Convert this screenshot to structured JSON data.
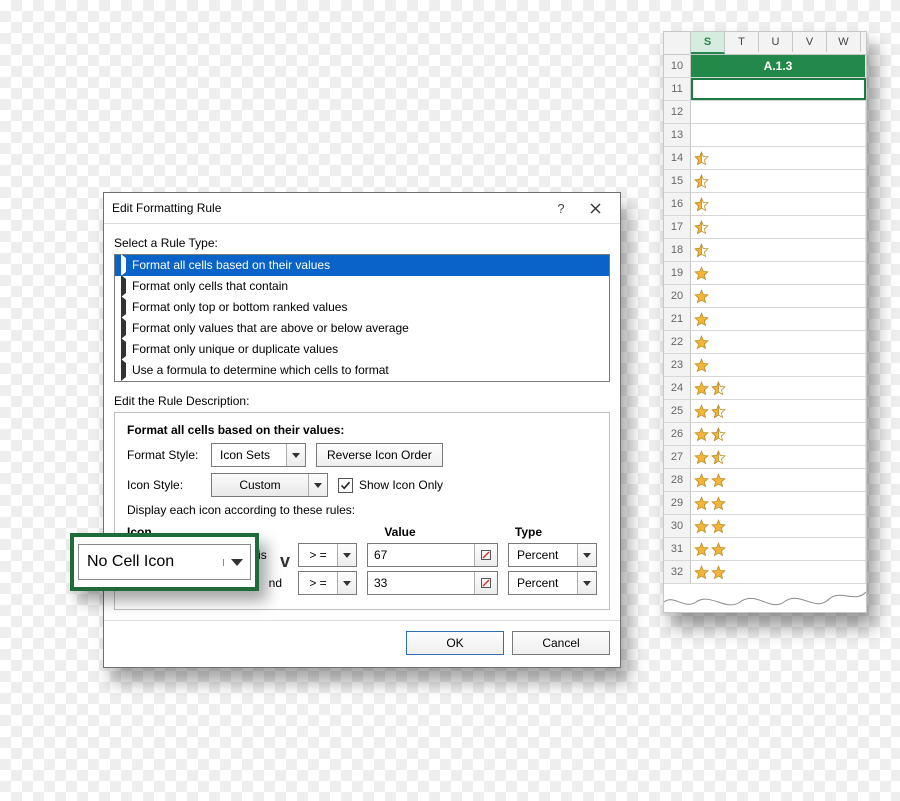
{
  "dialog": {
    "title": "Edit Formatting Rule",
    "help_symbol": "?",
    "select_label": "Select a Rule Type:",
    "rule_types": [
      "Format all cells based on their values",
      "Format only cells that contain",
      "Format only top or bottom ranked values",
      "Format only values that are above or below average",
      "Format only unique or duplicate values",
      "Use a formula to determine which cells to format"
    ],
    "edit_label": "Edit the Rule Description:",
    "desc_title": "Format all cells based on their values:",
    "format_style_label": "Format Style:",
    "format_style_value": "Icon Sets",
    "reverse_label": "Reverse Icon Order",
    "icon_style_label": "Icon Style:",
    "icon_style_value": "Custom",
    "show_icon_only_label": "Show Icon Only",
    "display_label": "Display each icon according to these rules:",
    "col_icon": "Icon",
    "col_value": "Value",
    "col_type": "Type",
    "when_label": "when value is",
    "and_label": "nd",
    "rules": [
      {
        "operator": "> =",
        "value": "67",
        "type": "Percent"
      },
      {
        "operator": "> =",
        "value": "33",
        "type": "Percent"
      }
    ],
    "ok_label": "OK",
    "cancel_label": "Cancel"
  },
  "callout": {
    "label": "No Cell Icon",
    "vtag": "v"
  },
  "sheet": {
    "columns": [
      "S",
      "T",
      "U",
      "V",
      "W"
    ],
    "active_column": "S",
    "title_cell": "A.1.3",
    "rows": [
      {
        "n": 10,
        "title": true
      },
      {
        "n": 11,
        "selected": true,
        "stars": []
      },
      {
        "n": 12,
        "stars": []
      },
      {
        "n": 13,
        "stars": []
      },
      {
        "n": 14,
        "stars": [
          "half"
        ]
      },
      {
        "n": 15,
        "stars": [
          "half"
        ]
      },
      {
        "n": 16,
        "stars": [
          "half"
        ]
      },
      {
        "n": 17,
        "stars": [
          "half"
        ]
      },
      {
        "n": 18,
        "stars": [
          "half"
        ]
      },
      {
        "n": 19,
        "stars": [
          "full"
        ]
      },
      {
        "n": 20,
        "stars": [
          "full"
        ]
      },
      {
        "n": 21,
        "stars": [
          "full"
        ]
      },
      {
        "n": 22,
        "stars": [
          "full"
        ]
      },
      {
        "n": 23,
        "stars": [
          "full"
        ]
      },
      {
        "n": 24,
        "stars": [
          "full",
          "half"
        ]
      },
      {
        "n": 25,
        "stars": [
          "full",
          "half"
        ]
      },
      {
        "n": 26,
        "stars": [
          "full",
          "half"
        ]
      },
      {
        "n": 27,
        "stars": [
          "full",
          "half"
        ]
      },
      {
        "n": 28,
        "stars": [
          "full",
          "full"
        ]
      },
      {
        "n": 29,
        "stars": [
          "full",
          "full"
        ]
      },
      {
        "n": 30,
        "stars": [
          "full",
          "full"
        ]
      },
      {
        "n": 31,
        "stars": [
          "full",
          "full"
        ]
      },
      {
        "n": 32,
        "stars": [
          "full",
          "full"
        ]
      }
    ]
  }
}
